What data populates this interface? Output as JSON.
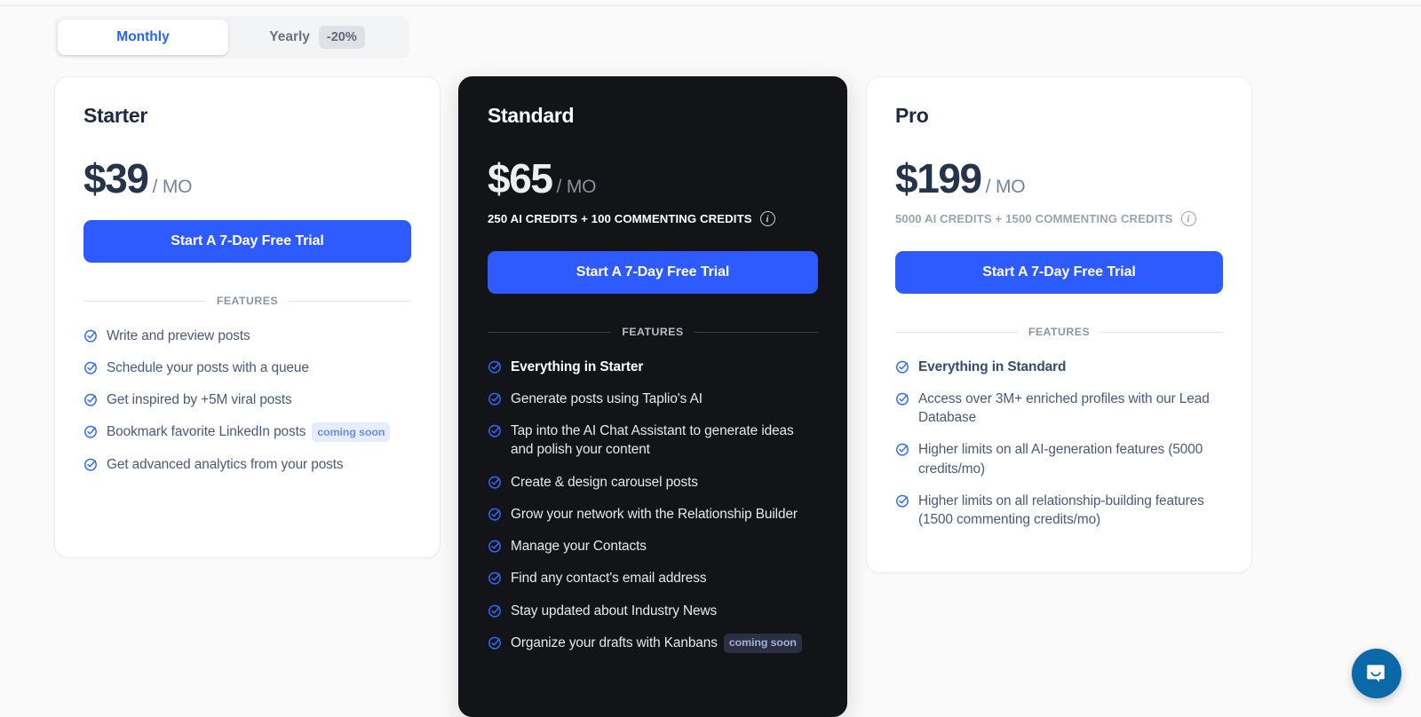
{
  "billing_toggle": {
    "monthly_label": "Monthly",
    "yearly_label": "Yearly",
    "discount_badge": "-20%",
    "selected": "Monthly"
  },
  "features_divider_label": "FEATURES",
  "colors": {
    "accent_blue": "#2e5bff",
    "link_blue": "#2563ff",
    "dark_card_bg": "#131417",
    "page_bg": "#fafafa",
    "intercom_blue": "#0a69a6"
  },
  "plans": [
    {
      "id": "starter",
      "name": "Starter",
      "currency": "$",
      "amount": "39",
      "period": "/ MO",
      "credits": null,
      "cta_label": "Start A 7-Day Free Trial",
      "features": [
        {
          "text": "Write and preview posts",
          "bold": false,
          "badge": null
        },
        {
          "text": "Schedule your posts with a queue",
          "bold": false,
          "badge": null
        },
        {
          "text": "Get inspired by +5M viral posts",
          "bold": false,
          "badge": null
        },
        {
          "text": "Bookmark favorite LinkedIn posts",
          "bold": false,
          "badge": "coming soon"
        },
        {
          "text": "Get advanced analytics from your posts",
          "bold": false,
          "badge": null
        }
      ]
    },
    {
      "id": "standard",
      "name": "Standard",
      "currency": "$",
      "amount": "65",
      "period": "/ MO",
      "credits": "250 AI CREDITS + 100 COMMENTING CREDITS",
      "cta_label": "Start A 7-Day Free Trial",
      "features": [
        {
          "text": "Everything in Starter",
          "bold": true,
          "badge": null
        },
        {
          "text": "Generate posts using Taplio's AI",
          "bold": false,
          "badge": null
        },
        {
          "text": "Tap into the AI Chat Assistant to generate ideas and polish your content",
          "bold": false,
          "badge": null
        },
        {
          "text": "Create & design carousel posts",
          "bold": false,
          "badge": null
        },
        {
          "text": "Grow your network with the Relationship Builder",
          "bold": false,
          "badge": null
        },
        {
          "text": "Manage your Contacts",
          "bold": false,
          "badge": null
        },
        {
          "text": "Find any contact's email address",
          "bold": false,
          "badge": null
        },
        {
          "text": "Stay updated about Industry News",
          "bold": false,
          "badge": null
        },
        {
          "text": "Organize your drafts with Kanbans",
          "bold": false,
          "badge": "coming soon"
        }
      ]
    },
    {
      "id": "pro",
      "name": "Pro",
      "currency": "$",
      "amount": "199",
      "period": "/ MO",
      "credits": "5000 AI CREDITS + 1500 COMMENTING CREDITS",
      "cta_label": "Start A 7-Day Free Trial",
      "features": [
        {
          "text": "Everything in Standard",
          "bold": true,
          "badge": null
        },
        {
          "text": "Access over 3M+ enriched profiles with our Lead Database",
          "bold": false,
          "badge": null
        },
        {
          "text": "Higher limits on all AI-generation features (5000 credits/mo)",
          "bold": false,
          "badge": null
        },
        {
          "text": "Higher limits on all relationship-building features (1500 commenting credits/mo)",
          "bold": false,
          "badge": null
        }
      ]
    }
  ],
  "intercom": {
    "icon": "chat-bubble-icon"
  }
}
